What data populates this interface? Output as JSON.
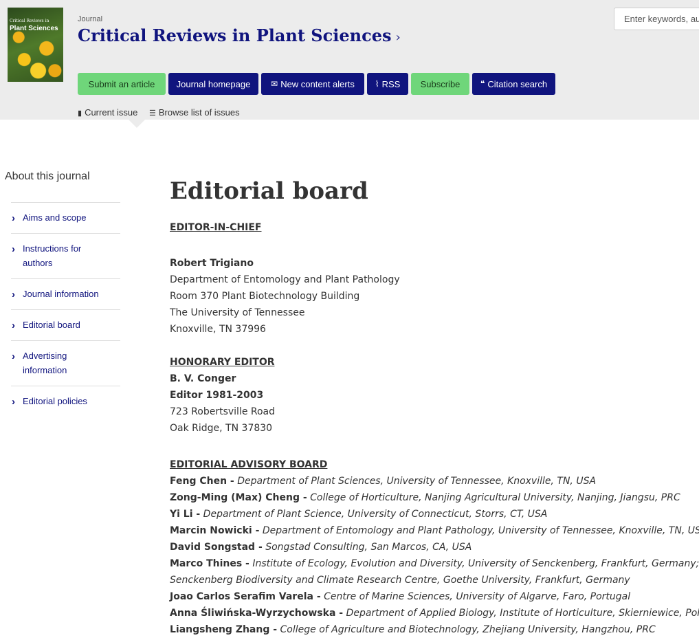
{
  "header": {
    "cover_text": [
      "Critical Reviews in",
      "Plant Sciences"
    ],
    "journal_label": "Journal",
    "journal_title": "Critical Reviews in Plant Sciences",
    "search_placeholder": "Enter keywords, au",
    "buttons": [
      {
        "label": "Submit an article",
        "icon": null,
        "color": "#6fd67a"
      },
      {
        "label": "Journal homepage",
        "icon": null,
        "color": "#10147e"
      },
      {
        "label": "New content alerts",
        "icon": "envelope-icon",
        "color": "#10147e"
      },
      {
        "label": "RSS",
        "icon": "rss-icon",
        "color": "#10147e"
      },
      {
        "label": "Subscribe",
        "icon": null,
        "color": "#6fd67a"
      },
      {
        "label": "Citation search",
        "icon": "quote-icon",
        "color": "#10147e"
      }
    ],
    "subnav": [
      {
        "label": "Current issue",
        "icon": "book-icon"
      },
      {
        "label": "Browse list of issues",
        "icon": "list-icon"
      }
    ]
  },
  "sidebar": {
    "heading": "About this journal",
    "items": [
      {
        "label": "Aims and scope"
      },
      {
        "label": "Instructions for authors"
      },
      {
        "label": "Journal information"
      },
      {
        "label": "Editorial board"
      },
      {
        "label": "Advertising information"
      },
      {
        "label": "Editorial policies"
      }
    ]
  },
  "main": {
    "title": "Editorial board",
    "editor_in_chief": {
      "heading": "EDITOR-IN-CHIEF",
      "name": "Robert Trigiano",
      "lines": [
        "Department of Entomology and Plant Pathology",
        "Room 370 Plant Biotechnology Building",
        "The University of Tennessee",
        "Knoxville, TN 37996"
      ]
    },
    "honorary_editor": {
      "heading": "HONORARY EDITOR",
      "name": "B. V. Conger",
      "role": "Editor 1981-2003",
      "lines": [
        "723 Robertsville Road",
        "Oak Ridge, TN 37830"
      ]
    },
    "advisory_board": {
      "heading": "EDITORIAL ADVISORY BOARD",
      "members": [
        {
          "name": "Feng Chen -",
          "affiliation": "Department of Plant Sciences, University of Tennessee, Knoxville, TN, USA"
        },
        {
          "name": "Zong-Ming (Max) Cheng -",
          "affiliation": "College of Horticulture, Nanjing Agricultural University, Nanjing, Jiangsu, PRC"
        },
        {
          "name": "Yi Li -",
          "affiliation": "Department of Plant Science, University of Connecticut, Storrs, CT, USA"
        },
        {
          "name": "Marcin Nowicki -",
          "affiliation": "Department of Entomology and Plant Pathology, University of Tennessee, Knoxville, TN, USA"
        },
        {
          "name": "David Songstad -",
          "affiliation": "Songstad Consulting, San Marcos, CA, USA"
        },
        {
          "name": "Marco Thines -",
          "affiliation": "Institute of Ecology, Evolution and Diversity, University of Senckenberg, Frankfurt, Germany; and",
          "affiliation_cont": "Senckenberg Biodiversity and Climate Research Centre, Goethe University, Frankfurt, Germany"
        },
        {
          "name": "Joao Carlos Serafim Varela -",
          "affiliation": "Centre of Marine Sciences, University of Algarve, Faro, Portugal"
        },
        {
          "name": "Anna Śliwińska-Wyrzychowska -",
          "affiliation": "Department of Applied Biology, Institute of Horticulture, Skierniewice, Poland"
        },
        {
          "name": "Liangsheng Zhang -",
          "affiliation": "College of Agriculture and Biotechnology, Zhejiang University, Hangzhou, PRC"
        }
      ]
    }
  }
}
